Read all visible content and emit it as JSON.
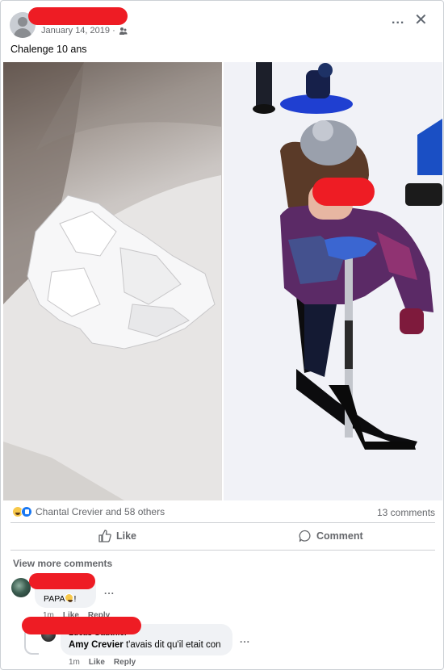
{
  "post": {
    "author_redacted": true,
    "date": "January 14, 2019 ·",
    "audience_icon": "friends-icon",
    "text": "Chalenge 10 ans",
    "more_icon": "...",
    "close_icon": "✕"
  },
  "photos": [
    {
      "alt": "crumpled tissue on white surface",
      "side": "left"
    },
    {
      "alt": "child in snow with ski scooter",
      "side": "right"
    }
  ],
  "engagement": {
    "reactions": [
      "haha",
      "like"
    ],
    "reactors": "Chantal Crevier and 58 others",
    "comments_count": "13 comments"
  },
  "actions": {
    "like": "Like",
    "comment": "Comment"
  },
  "view_more": "View more comments",
  "comments": [
    {
      "author_redacted": true,
      "text_before": "PAPA",
      "emoji": "haha",
      "text_after": "!",
      "time": "1m",
      "like": "Like",
      "reply": "Reply"
    },
    {
      "author": "Lucas Gauthier",
      "mention": "Amy Crevier",
      "text": " t'avais dit qu'il etait con",
      "time": "1m",
      "like": "Like",
      "reply": "Reply"
    }
  ],
  "colors": {
    "redaction": "#ee1c24",
    "like_blue": "#1877f2",
    "muted": "#65676b"
  }
}
